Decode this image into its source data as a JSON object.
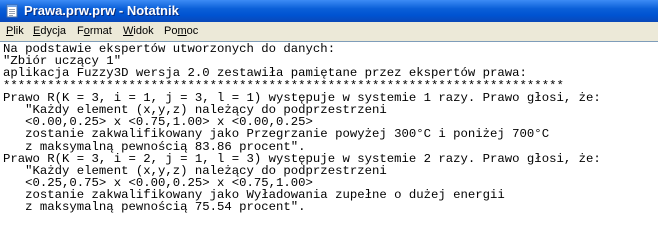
{
  "window": {
    "title": "Prawa.prw.prw - Notatnik",
    "app_icon": "notepad-icon"
  },
  "menu": {
    "items": [
      {
        "label": "Plik",
        "accel": "P",
        "rest": "lik"
      },
      {
        "label": "Edycja",
        "accel": "E",
        "rest": "dycja"
      },
      {
        "label": "Format",
        "accel": "o",
        "pre": "F",
        "rest": "rmat"
      },
      {
        "label": "Widok",
        "accel": "W",
        "rest": "idok"
      },
      {
        "label": "Pomoc",
        "accel": "m",
        "pre": "Po",
        "rest": "oc"
      }
    ]
  },
  "document": {
    "lines": [
      "Na podstawie ekspertów utworzonych do danych:",
      "\"Zbiór uczący 1\"",
      "aplikacja Fuzzy3D wersja 2.0 zestawiła pamiętane przez ekspertów prawa:",
      "****************************************************************************",
      "Prawo R(K = 3, i = 1, j = 3, l = 1) występuje w systemie 1 razy. Prawo głosi, że:",
      "   \"Każdy element (x,y,z) należący do podprzestrzeni",
      "   <0.00,0.25> x <0.75,1.00> x <0.00,0.25>",
      "   zostanie zakwalifikowany jako Przegrzanie powyżej 300°C i poniżej 700°C",
      "   z maksymalną pewnością 83.86 procent\".",
      "Prawo R(K = 3, i = 2, j = 1, l = 3) występuje w systemie 2 razy. Prawo głosi, że:",
      "   \"Każdy element (x,y,z) należący do podprzestrzeni",
      "   <0.25,0.75> x <0.00,0.25> x <0.75,1.00>",
      "   zostanie zakwalifikowany jako Wyładowania zupełne o dużej energii",
      "   z maksymalną pewnością 75.54 procent\"."
    ]
  }
}
